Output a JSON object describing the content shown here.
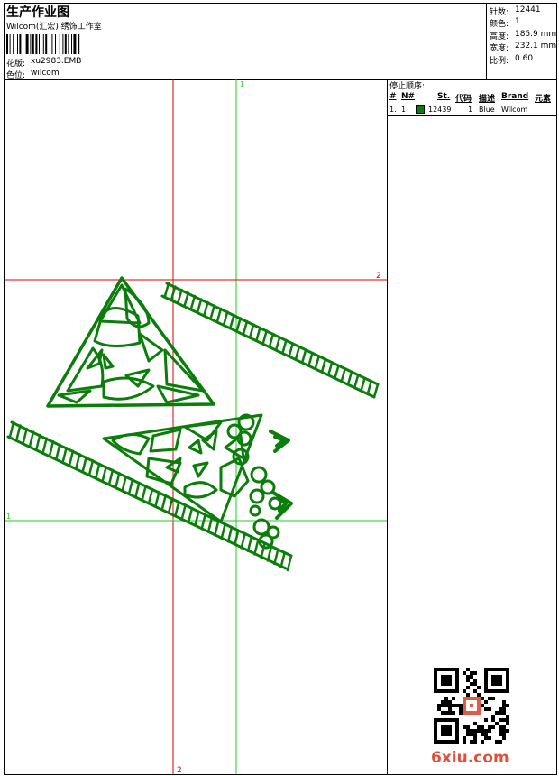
{
  "header": {
    "title": "生产作业图",
    "subtitle": "Wilcom(汇宏) 绣饰工作室",
    "design_label": "花版:",
    "design_value": "xu2983.EMB",
    "colorway_label": "色位:",
    "colorway_value": "wilcom"
  },
  "stats": [
    {
      "label": "针数:",
      "value": "12441"
    },
    {
      "label": "颜色:",
      "value": "1"
    },
    {
      "label": "高度:",
      "value": "185.9 mm"
    },
    {
      "label": "宽度:",
      "value": "232.1 mm"
    },
    {
      "label": "比例:",
      "value": "0.60"
    }
  ],
  "stop_sequence": {
    "heading": "停止顺序:",
    "columns": [
      "#",
      "N#",
      "St.",
      "代码",
      "描述",
      "Brand",
      "元素"
    ],
    "rows": [
      {
        "index": "1.",
        "needle": "1",
        "stitches": "12439",
        "code": "1",
        "description": "Blue",
        "brand": "Wilcom",
        "color": "#0a7d0a"
      }
    ]
  },
  "guides": {
    "v_red_label": "2",
    "v_green_label": "1",
    "h_red_label": "2",
    "h_green_label": "1"
  },
  "watermark": {
    "text": "6xiu.com",
    "qr_icon": "qr-code-icon"
  },
  "colors": {
    "embroidery": "#0a7d0a",
    "guide_red": "#e00000",
    "guide_green": "#22cc22"
  }
}
